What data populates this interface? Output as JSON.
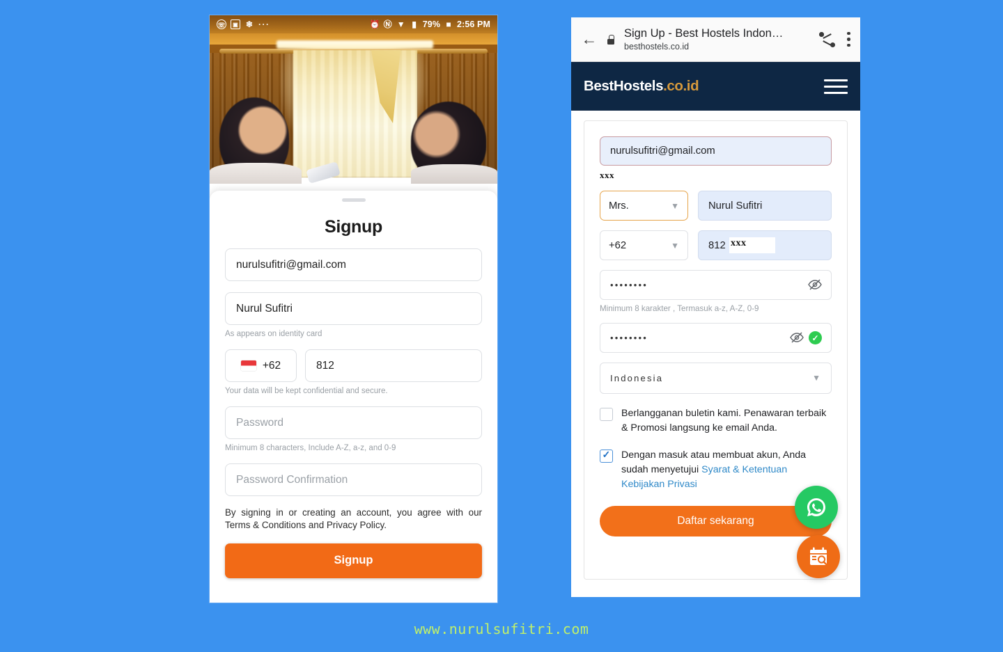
{
  "background_color": "#3b92ef",
  "left_phone": {
    "statusbar": {
      "icons_left": [
        "whatsapp-icon",
        "image-icon",
        "snowflake-icon",
        "more-dots-icon"
      ],
      "dots": "···",
      "icons_right": [
        "alarm-icon",
        "bluetooth-icon",
        "wifi-icon",
        "signal-icon"
      ],
      "battery_percent": "79%",
      "battery_icon": "battery-icon",
      "time": "2:56 PM"
    },
    "photo_alt": "two-women-laughing-in-bamboo-room",
    "title": "Signup",
    "email_value": "nurulsufitri@gmail.com",
    "name_value": "Nurul Sufitri",
    "name_hint": "As appears on identity card",
    "country_code": "+62",
    "country_flag": "indonesia-flag",
    "phone_value": "812",
    "phone_hint": "Your data will be kept confidential and secure.",
    "password_placeholder": "Password",
    "password_hint": "Minimum 8 characters, Include A-Z, a-z, and 0-9",
    "password_confirm_placeholder": "Password Confirmation",
    "terms_text": "By signing in or creating an account, you agree with our Terms & Conditions and Privacy Policy.",
    "submit_label": "Signup",
    "submit_color": "#f26a16"
  },
  "right_phone": {
    "chrome": {
      "back_icon": "back-arrow-icon",
      "lock_icon": "lock-icon",
      "page_title": "Sign Up - Best Hostels Indon…",
      "host": "besthostels.co.id",
      "share_icon": "share-icon",
      "menu_icon": "overflow-menu-icon"
    },
    "site_header": {
      "logo_main": "BestHostels",
      "logo_suffix": ".co.id",
      "logo_color_main": "#ffffff",
      "logo_color_suffix": "#d79a3c",
      "background": "#0e2744",
      "menu_icon": "hamburger-menu-icon"
    },
    "form": {
      "email_value": "nurulsufitri@gmail.com",
      "email_error": "xxx",
      "title_value": "Mrs.",
      "name_value": "Nurul Sufitri",
      "country_code": "+62",
      "phone_prefix": "812",
      "phone_redacted": "xxx",
      "password_value": "••••••••",
      "password_hint": "Minimum 8 karakter , Termasuk a-z, A-Z, 0-9",
      "password_confirm_value": "••••••••",
      "country_value": "Indonesia",
      "newsletter_label": "Berlangganan buletin kami. Penawaran terbaik & Promosi langsung ke email Anda.",
      "newsletter_checked": false,
      "terms_prefix": "Dengan masuk atau membuat akun, Anda sudah menyetujui ",
      "terms_link1": "Syarat & Ketentuan",
      "terms_link2": "Kebijakan Privasi",
      "terms_checked": true,
      "submit_label": "Daftar sekarang",
      "submit_color": "#f2701a",
      "link_color": "#2f89c8"
    },
    "fabs": [
      {
        "name": "whatsapp-fab",
        "color": "#25c963"
      },
      {
        "name": "calendar-search-fab",
        "color": "#ef6c16"
      }
    ]
  },
  "watermark": "www.nurulsufitri.com"
}
